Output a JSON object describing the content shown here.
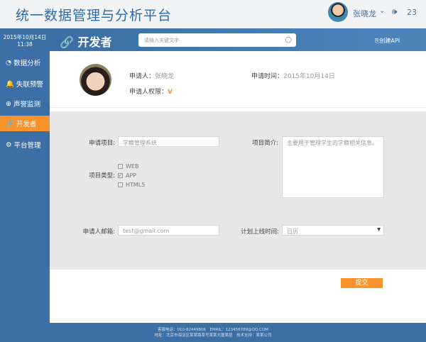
{
  "header": {
    "title": "统一数据管理与分析平台",
    "user": "张晓龙",
    "notification_count": "23"
  },
  "sidebar": {
    "date": "2015年10月14日",
    "time": "11:38",
    "items": [
      {
        "label": "数据分析",
        "icon": "pie-chart-icon"
      },
      {
        "label": "失联预警",
        "icon": "bell-icon"
      },
      {
        "label": "声誉监测",
        "icon": "globe-icon"
      },
      {
        "label": "开发者",
        "icon": "link-icon",
        "active": true
      },
      {
        "label": "平台管理",
        "icon": "gears-icon"
      }
    ]
  },
  "banner": {
    "title": "开发者",
    "search_placeholder": "请输入关键文字",
    "create_api": "创建API"
  },
  "applicant": {
    "name_label": "申请人：",
    "name": "张晓龙",
    "time_label": "申请时间：",
    "time": "2015年10月14日",
    "perm_label": "申请人权限：",
    "perm_icon": "V"
  },
  "form": {
    "project_label": "申请项目:",
    "project_value": "学籍管理系统",
    "type_label": "项目类型:",
    "types": [
      {
        "label": "WEB",
        "checked": false
      },
      {
        "label": "APP",
        "checked": true
      },
      {
        "label": "HTML5",
        "checked": false
      }
    ],
    "intro_label": "项目简介:",
    "intro_value": "主要用于管理学生的学籍相关信息。",
    "email_label": "申请人邮箱:",
    "email_value": "test@gmail.com",
    "launch_label": "计划上线时间:",
    "launch_value": "日历",
    "submit": "提交"
  },
  "footer": {
    "line1": "客服电话：010-82449806　EMAIL：123456789@QQ.COM",
    "line2": "地址：北京市海淀区某某路某号某某大厦某层　技术支持：某某公司"
  },
  "colors": {
    "primary": "#3c6fa6",
    "accent": "#f7932a"
  }
}
